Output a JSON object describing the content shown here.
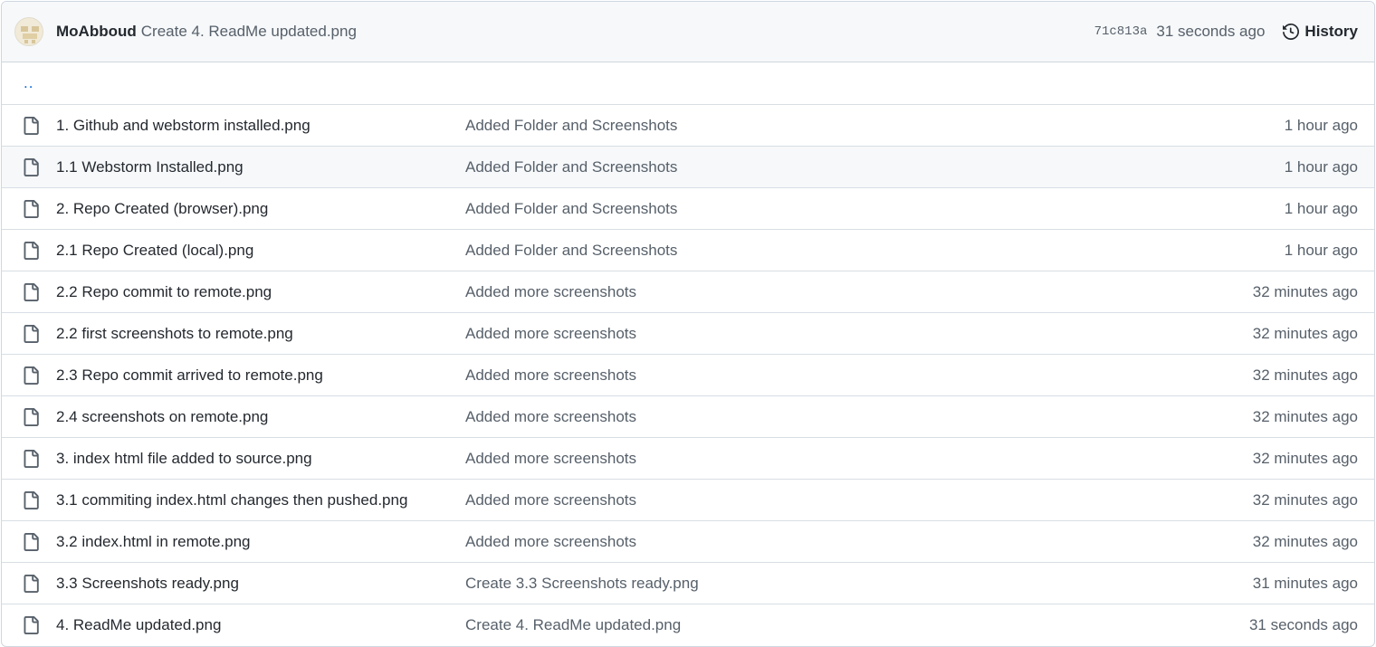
{
  "latest_commit": {
    "author": "MoAbboud",
    "message": "Create 4. ReadMe updated.png",
    "sha": "71c813a",
    "time": "31 seconds ago",
    "history_label": "History"
  },
  "parent_dir_label": "..",
  "files": [
    {
      "name": "1. Github and webstorm installed.png",
      "message": "Added Folder and Screenshots",
      "time": "1 hour ago"
    },
    {
      "name": "1.1 Webstorm Installed.png",
      "message": "Added Folder and Screenshots",
      "time": "1 hour ago"
    },
    {
      "name": "2. Repo Created (browser).png",
      "message": "Added Folder and Screenshots",
      "time": "1 hour ago"
    },
    {
      "name": "2.1 Repo Created (local).png",
      "message": "Added Folder and Screenshots",
      "time": "1 hour ago"
    },
    {
      "name": "2.2 Repo commit to remote.png",
      "message": "Added more screenshots",
      "time": "32 minutes ago"
    },
    {
      "name": "2.2 first screenshots to remote.png",
      "message": "Added more screenshots",
      "time": "32 minutes ago"
    },
    {
      "name": "2.3 Repo commit arrived to remote.png",
      "message": "Added more screenshots",
      "time": "32 minutes ago"
    },
    {
      "name": "2.4 screenshots on remote.png",
      "message": "Added more screenshots",
      "time": "32 minutes ago"
    },
    {
      "name": "3. index html file added to source.png",
      "message": "Added more screenshots",
      "time": "32 minutes ago"
    },
    {
      "name": "3.1 commiting index.html changes then pushed.png",
      "message": "Added more screenshots",
      "time": "32 minutes ago"
    },
    {
      "name": "3.2 index.html in remote.png",
      "message": "Added more screenshots",
      "time": "32 minutes ago"
    },
    {
      "name": "3.3 Screenshots ready.png",
      "message": "Create 3.3 Screenshots ready.png",
      "time": "31 minutes ago"
    },
    {
      "name": "4. ReadMe updated.png",
      "message": "Create 4. ReadMe updated.png",
      "time": "31 seconds ago"
    }
  ],
  "icons": {
    "file": "file-icon",
    "history": "history-icon",
    "avatar": "avatar"
  },
  "colors": {
    "link": "#0969da",
    "header_bg": "#f6f8fa",
    "border": "#d0d7de",
    "muted_text": "#57606a"
  }
}
